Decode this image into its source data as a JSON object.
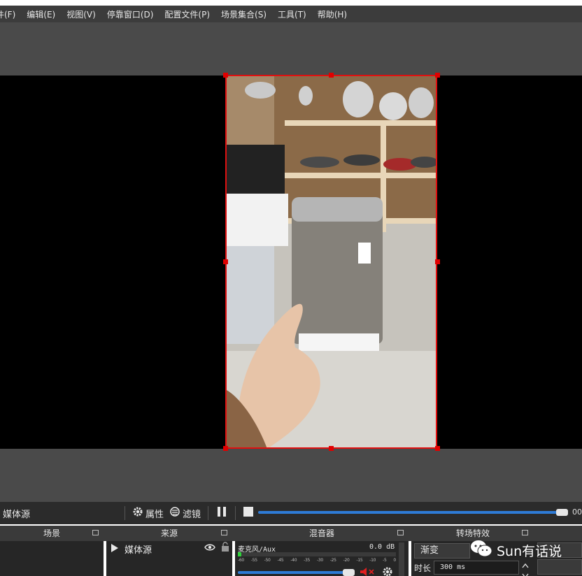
{
  "menu": [
    "件(F)",
    "编辑(E)",
    "视图(V)",
    "停靠窗口(D)",
    "配置文件(P)",
    "场景集合(S)",
    "工具(T)",
    "帮助(H)"
  ],
  "controls": {
    "source_name": "媒体源",
    "properties_label": "属性",
    "filters_label": "滤镜",
    "time": "00"
  },
  "docks": {
    "scenes_title": "场景",
    "sources_title": "来源",
    "mixer_title": "混音器",
    "transitions_title": "转场特效"
  },
  "sources": {
    "items": [
      {
        "label": "媒体源",
        "visible": true,
        "locked": false
      }
    ]
  },
  "mixer": {
    "channel_label": "麦克风/Aux",
    "db_value": "0.0 dB",
    "scale": [
      "-60",
      "-55",
      "-50",
      "-45",
      "-40",
      "-35",
      "-30",
      "-25",
      "-20",
      "-15",
      "-10",
      "-5",
      "0"
    ],
    "level": 0.02,
    "volume": 0.95
  },
  "transitions": {
    "selected": "渐变",
    "duration_label": "时长",
    "duration_value": "300 ms"
  },
  "watermark": {
    "text": "Sun有话说",
    "icon": "wechat-icon"
  },
  "colors": {
    "selection": "#e01010",
    "accent": "#2e7bd6",
    "meter_green": "#2fd23a"
  }
}
